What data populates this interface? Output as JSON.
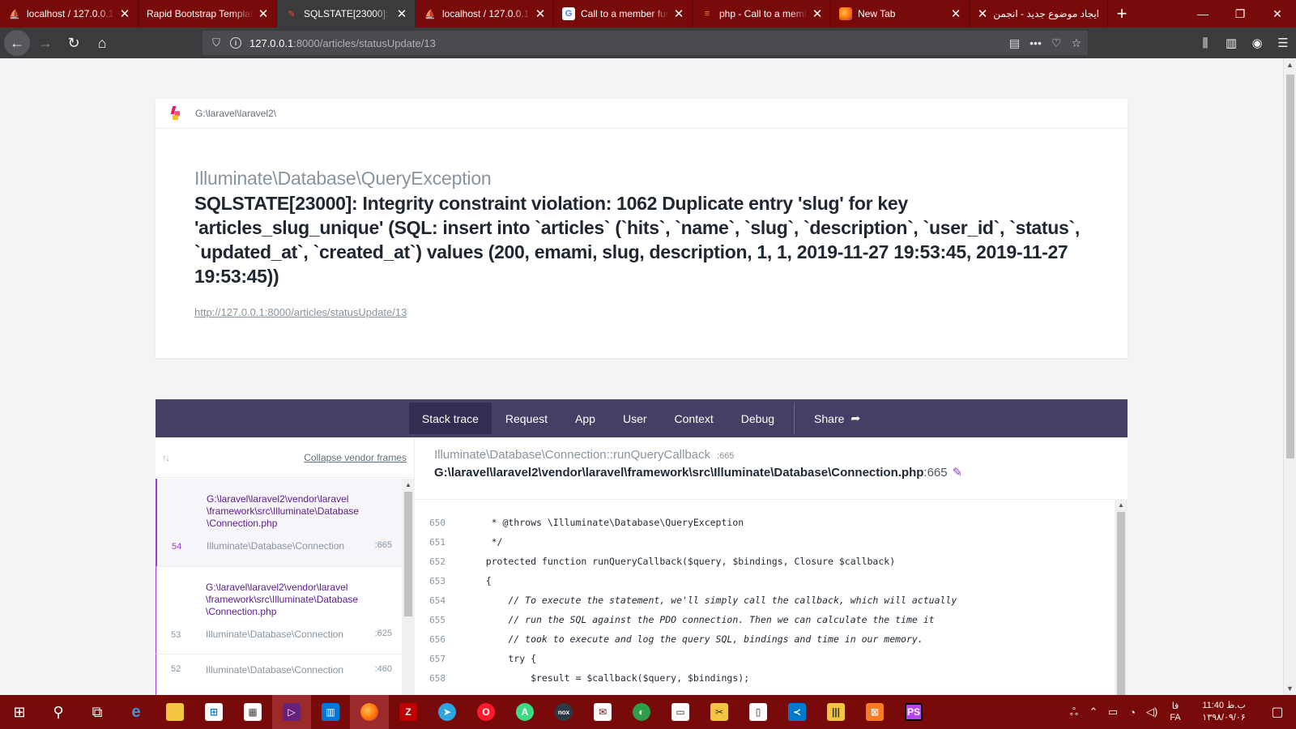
{
  "browser": {
    "tabs": [
      {
        "title": "localhost / 127.0.0.1 / ",
        "favicon": "phpmyadmin-icon",
        "active": false
      },
      {
        "title": "Rapid Bootstrap Template",
        "favicon": "",
        "active": false
      },
      {
        "title": "SQLSTATE[23000]: Integ",
        "favicon": "laravel-icon",
        "active": true
      },
      {
        "title": "localhost / 127.0.0.1 / ",
        "favicon": "phpmyadmin-icon",
        "active": false
      },
      {
        "title": "Call to a member func",
        "favicon": "google-icon",
        "active": false
      },
      {
        "title": "php - Call to a memb",
        "favicon": "stackoverflow-icon",
        "active": false
      },
      {
        "title": "New Tab",
        "favicon": "firefox-icon",
        "active": false
      },
      {
        "title": "ایجاد موضوع جدید - انجمن",
        "favicon": "",
        "active": false
      }
    ],
    "url_host": "127.0.0.1",
    "url_rest": ":8000/articles/statusUpdate/13"
  },
  "ignition": {
    "root_path": "G:\\laravel\\laravel2\\",
    "exception_class": "Illuminate\\Database\\QueryException",
    "exception_message": "SQLSTATE[23000]: Integrity constraint violation: 1062 Duplicate entry 'slug' for key 'articles_slug_unique' (SQL: insert into `articles` (`hits`, `name`, `slug`, `description`, `user_id`, `status`, `updated_at`, `created_at`) values (200, emami, slug, description, 1, 1, 2019-11-27 19:53:45, 2019-11-27 19:53:45))",
    "request_url": "http://127.0.0.1:8000/articles/statusUpdate/13",
    "tabs": [
      "Stack trace",
      "Request",
      "App",
      "User",
      "Context",
      "Debug"
    ],
    "share_label": "Share",
    "collapse_label": "Collapse vendor frames",
    "frames": [
      {
        "number": "54",
        "file": "G:\\laravel\\laravel2\\vendor\\laravel\n\\framework\\src\\Illuminate\\Database\n\\Connection.php",
        "class": "Illuminate\\Database\\Connection",
        "line": ":665"
      },
      {
        "number": "53",
        "file": "G:\\laravel\\laravel2\\vendor\\laravel\n\\framework\\src\\Illuminate\\Database\n\\Connection.php",
        "class": "Illuminate\\Database\\Connection",
        "line": ":625"
      },
      {
        "number": "52",
        "file": "",
        "class": "Illuminate\\Database\\Connection",
        "line": ":460"
      }
    ],
    "selected_frame": {
      "class_method": "Illuminate\\Database\\Connection::runQueryCallback",
      "line_badge": ":665",
      "file": "G:\\laravel\\laravel2\\vendor\\laravel\\framework\\src\\Illuminate\\Database\\Connection.php",
      "line": ":665"
    },
    "code_lines": [
      {
        "no": "650",
        "text": "     * @throws \\Illuminate\\Database\\QueryException"
      },
      {
        "no": "651",
        "text": "     */"
      },
      {
        "no": "652",
        "text": "    protected function runQueryCallback($query, $bindings, Closure $callback)"
      },
      {
        "no": "653",
        "text": "    {"
      },
      {
        "no": "654",
        "text": "        // To execute the statement, we'll simply call the callback, which will actually"
      },
      {
        "no": "655",
        "text": "        // run the SQL against the PDO connection. Then we can calculate the time it"
      },
      {
        "no": "656",
        "text": "        // took to execute and log the query SQL, bindings and time in our memory."
      },
      {
        "no": "657",
        "text": "        try {"
      },
      {
        "no": "658",
        "text": "            $result = $callback($query, $bindings);"
      }
    ]
  },
  "taskbar": {
    "apps": [
      "start-icon",
      "search-icon",
      "task-view-icon",
      "edge-icon",
      "file-explorer-icon",
      "store-icon",
      "calculator-icon",
      "visual-studio-icon",
      "power-bi-icon",
      "firefox-icon",
      "filezilla-icon",
      "telegram-icon",
      "opera-icon",
      "android-studio-icon",
      "nox-icon",
      "mail-icon",
      "map-icon",
      "notepad-icon",
      "app-icon",
      "document-icon",
      "vscode-icon",
      "library-icon",
      "xampp-icon",
      "phpstorm-icon"
    ],
    "lang_top": "فا",
    "lang_bottom": "FA",
    "time": "11:40 ب.ظ",
    "date": "۱۳۹۸/۰۹/۰۶"
  },
  "colors": {
    "tab_bar": "#780a0a",
    "toolbar": "#3b3b3e",
    "ignition_nav": "#443f65",
    "accent_purple": "#9c39d1"
  }
}
